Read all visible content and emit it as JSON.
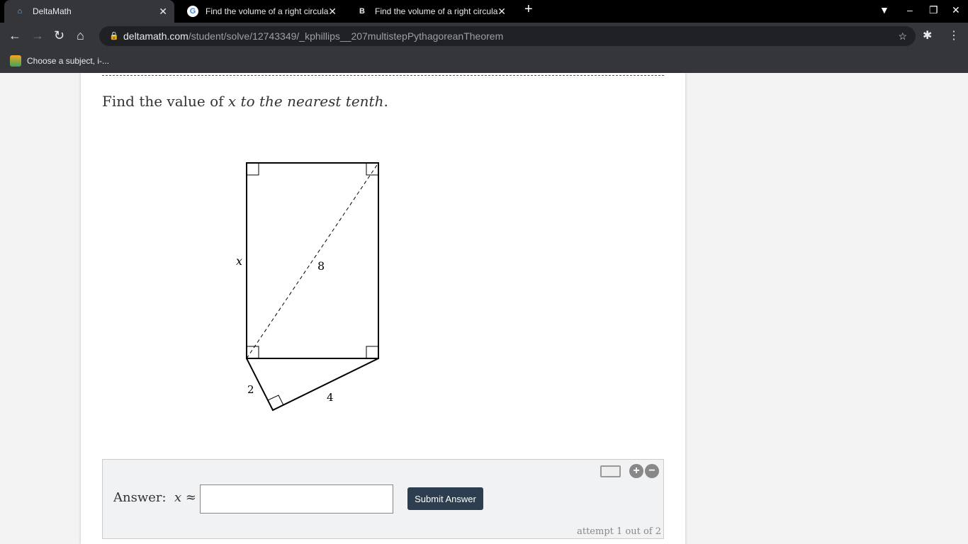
{
  "browser": {
    "tabs": [
      {
        "title": "DeltaMath",
        "icon": "deltamath-icon"
      },
      {
        "title": "Find the volume of a right circula",
        "icon": "google-icon"
      },
      {
        "title": "Find the volume of a right circula",
        "icon": "brainly-icon"
      }
    ],
    "url_domain": "deltamath.com",
    "url_path": "/student/solve/12743349/_kphillips__207multistepPythagoreanTheorem",
    "bookmark": "Choose a subject, i-..."
  },
  "question": {
    "prefix": "Find the value of ",
    "var": "x",
    "suffix": " to the nearest tenth",
    "period": "."
  },
  "diagram": {
    "label_x": "x",
    "label_diag": "8",
    "label_short": "2",
    "label_long": "4"
  },
  "answer": {
    "label": "Answer:",
    "var": "x",
    "symbol": "≈",
    "value": "",
    "submit": "Submit Answer",
    "attempt": "attempt 1 out of 2"
  }
}
